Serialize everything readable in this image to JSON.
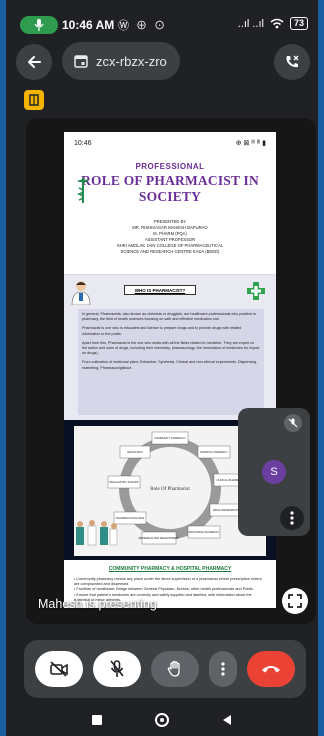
{
  "status_bar": {
    "time": "10:46 AM",
    "notification_icons": "Ⓦ ⊕ ⊙",
    "signal": "..ıl ..ıl",
    "battery": "73"
  },
  "meeting": {
    "code": "zcx-rbzx-zro"
  },
  "shared_doc": {
    "phone_time": "10:46",
    "phone_status": "⊕ ⊠ ᴵᴵˡ ᴵᴵˡ ▮",
    "title_prefix": "PROFESSIONAL",
    "title_main": "ROLE OF PHARMACIST IN SOCIETY",
    "presented_lines": [
      "Presented by",
      "MR. RISHISAGAR MAHESH BAPURAO",
      "M. PHARM (PQA)",
      "ASSISTANT PROFESSOR",
      "SHRI AMOLAK JAIN COLLEGE OF PHARMACEUTICAL",
      "SCIENCE AND RESEARCH CENTRE KADA (BEED)"
    ],
    "section_heading": "WHO IS PHARMACIST?",
    "paragraphs": [
      "In general, Pharmacists, also known as chemists or druggists, are healthcare professionals who practice in pharmacy, the field of health sciences focusing on safe and effective medication use.",
      "Pharmacist is one who is educated and licence to prepare drugs and to provide drugs with related information to the public.",
      "Apart from this, Pharmacist is the one who deals with all the fields related to medicine. They are expert on the action and uses of drugs, including their chemistry, pharmacology, the formulation of medicines for export on drugs).",
      "From cultivation of medicinal plant, Extraction, Synthesis, Clinical and non-clinical experiments, Dispensing, marketing, Pharmacovigilance."
    ],
    "diagram_center": "Role Of Pharmacist",
    "diagram_nodes": [
      "COMMUNITY PHARMACY",
      "HOSPITAL PHARMACY",
      "CLINICAL PHARMACY",
      "DRUG INFORMATION",
      "INDUSTRIAL PHARMACY",
      "RESEARCH AND DEVELOPMENT",
      "PHARMACOVIGILANCE",
      "REGULATORY AFFAIRS",
      "EDUCATION"
    ],
    "bottom_heading": "COMMUNITY PHARMACY & HOSPITAL PHARMACY",
    "bullets": [
      "Community pharmacy means any place under the direct supervision of a pharmacist where prescription orders are compounded and dispensed.",
      "Frontline of healthcare; Bridge between General Physician, Nurses, other health professionals and Public.",
      "Ensure that patient's medicines are correctly and safely supplied and labelled, with information about the treatment of minor ailments."
    ]
  },
  "presenter_label": "Mahesh is presenting",
  "participant": {
    "initial": "S"
  },
  "icons": {
    "back": "back-arrow-icon",
    "calendar": "calendar-icon",
    "phone": "phone-audio-icon",
    "tag": "door-icon",
    "camera_off": "camera-off-icon",
    "mic_off": "mic-off-icon",
    "hand": "raise-hand-icon",
    "more": "more-vertical-icon",
    "end_call": "end-call-icon"
  },
  "colors": {
    "end_call": "#ea4335",
    "title_purple": "#6a2e97",
    "avatar": "#6a3fa0",
    "mic_pill": "#2e9b4f"
  }
}
